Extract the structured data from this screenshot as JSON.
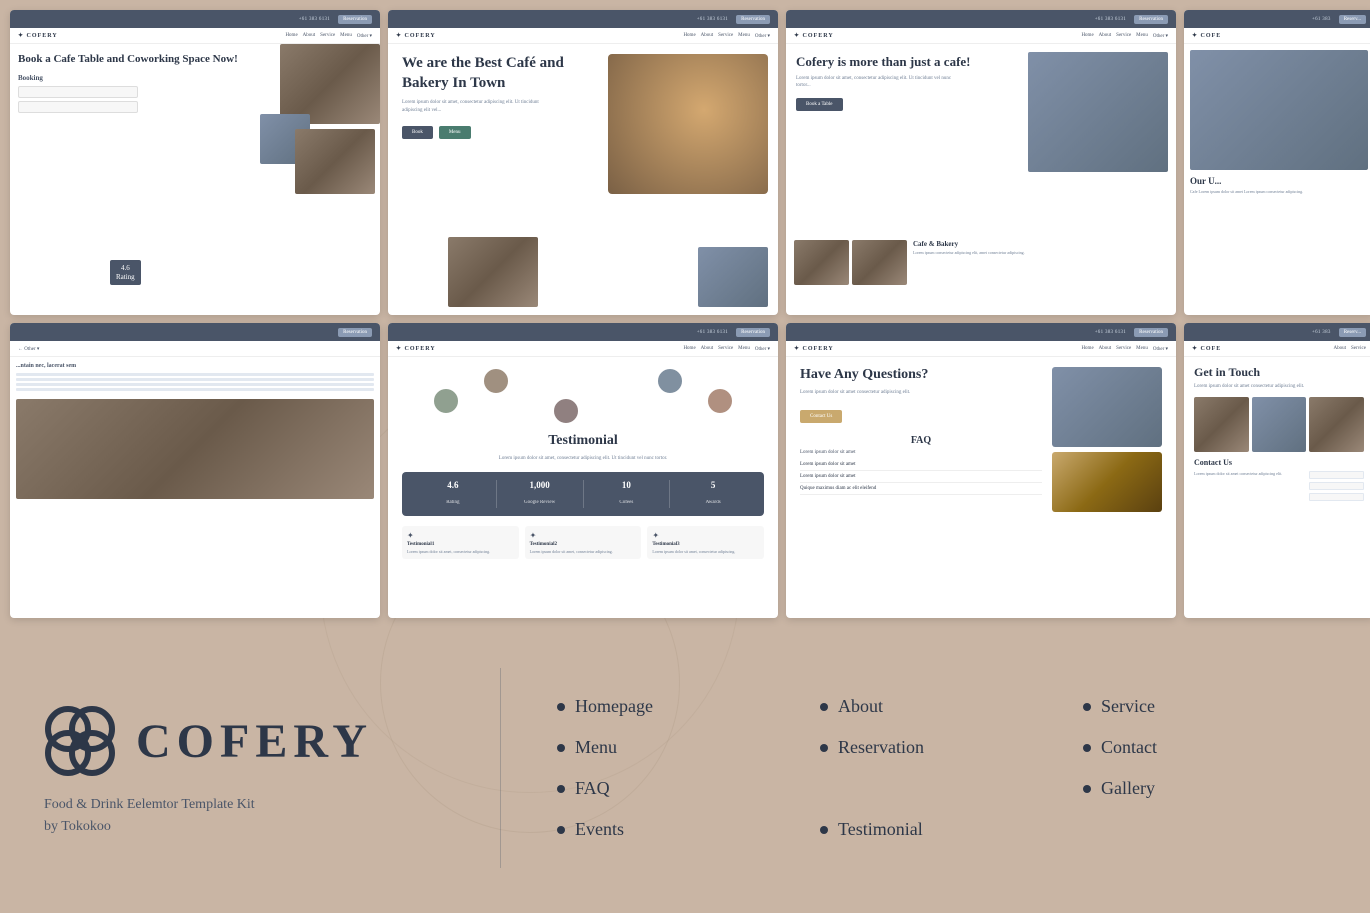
{
  "brand": {
    "name": "COFERY",
    "tagline": "Food & Drink Eelemtor Template Kit",
    "by": "by Tokokoo"
  },
  "phone": "+61 383 6131",
  "topbar_btn": "Reservation",
  "screenshots": [
    {
      "id": "ss1",
      "title": "Book a Cafe Table and Coworking Space Now!",
      "booking_label": "Booking",
      "rating": "4.6",
      "rating_label": "Rating"
    },
    {
      "id": "ss2",
      "title": "We are the Best Café and Bakery In Town"
    },
    {
      "id": "ss3",
      "title": "Cofery is more than just a cafe!",
      "btn": "Book a Table",
      "bakery_title": "Cafe & Bakery"
    },
    {
      "id": "ss4",
      "title": "Our U..."
    },
    {
      "id": "ss5",
      "title": ""
    },
    {
      "id": "ss6",
      "title": "Testimonial",
      "stats": [
        {
          "value": "4.6",
          "label": "Rating"
        },
        {
          "value": "1,000",
          "label": "Google Review"
        },
        {
          "value": "10",
          "label": "Cofees"
        },
        {
          "value": "5",
          "label": "Awards"
        }
      ]
    },
    {
      "id": "ss7",
      "title": "Have Any Questions?",
      "btn": "Contact Us",
      "faq_title": "FAQ",
      "faq_question": "Lorem ipsum dolor sit amet"
    },
    {
      "id": "ss8",
      "title": "Get in Touch",
      "contact_title": "Contact Us"
    }
  ],
  "nav_links": {
    "col1": [
      {
        "label": "Homepage"
      },
      {
        "label": "About"
      },
      {
        "label": "Service"
      },
      {
        "label": "Menu"
      }
    ],
    "col2": [
      {
        "label": "Reservation"
      },
      {
        "label": "Contact"
      },
      {
        "label": "FAQ"
      }
    ],
    "col3": [
      {
        "label": "Gallery"
      },
      {
        "label": "Events"
      },
      {
        "label": "Testimonial"
      }
    ]
  }
}
